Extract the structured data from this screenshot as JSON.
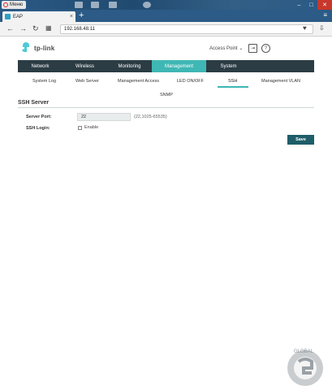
{
  "browser": {
    "menu_label": "Меню",
    "tab_title": "EAP",
    "new_tab": "+",
    "address": "192.168.48.11",
    "window_controls": {
      "minimize": "–",
      "maximize": "□",
      "close": "✕"
    }
  },
  "header": {
    "logo_text": "tp-link",
    "mode": "Access Point",
    "icons": [
      "logout-icon",
      "help-icon"
    ]
  },
  "main_nav": {
    "items": [
      "Network",
      "Wireless",
      "Monitoring",
      "Management",
      "System"
    ],
    "active": "Management"
  },
  "sub_nav": {
    "items": [
      "System Log",
      "Web Server",
      "Management Access",
      "LED ON/OFF",
      "SSH",
      "Management VLAN",
      "SNMP"
    ],
    "active": "SSH"
  },
  "section": {
    "title": "SSH Server",
    "server_port_label": "Server Port:",
    "server_port_value": "22",
    "server_port_hint": "(22,1025-65535)",
    "ssh_login_label": "SSH Login:",
    "enable_label": "Enable",
    "enable_checked": false,
    "save_label": "Save"
  },
  "watermark": {
    "text": "GLOBAL"
  },
  "colors": {
    "nav_bg": "#2c3c44",
    "accent": "#3fb7b4",
    "save_btn": "#1f5d69"
  }
}
